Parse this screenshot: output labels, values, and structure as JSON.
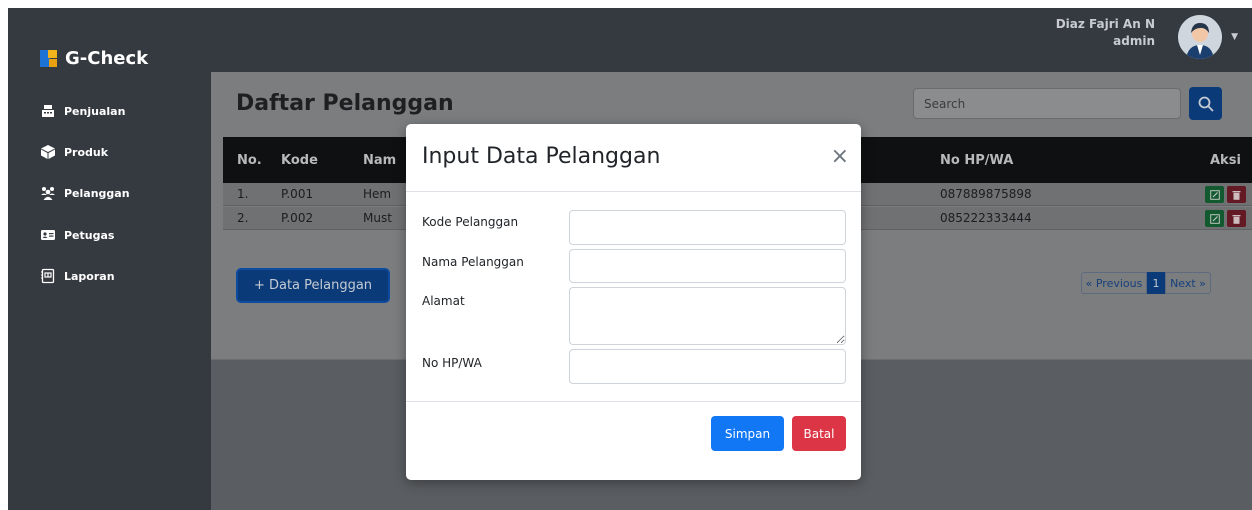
{
  "app": {
    "brand": "G-Check"
  },
  "sidebar": {
    "items": [
      {
        "label": "Penjualan",
        "icon": "cash-register-icon"
      },
      {
        "label": "Produk",
        "icon": "box-icon"
      },
      {
        "label": "Pelanggan",
        "icon": "users-icon"
      },
      {
        "label": "Petugas",
        "icon": "id-card-icon"
      },
      {
        "label": "Laporan",
        "icon": "report-icon"
      }
    ]
  },
  "user": {
    "name": "Diaz Fajri An N",
    "role": "admin"
  },
  "page": {
    "title": "Daftar Pelanggan",
    "search_placeholder": "Search"
  },
  "table": {
    "columns": [
      "No.",
      "Kode",
      "Nam",
      "No HP/WA",
      "Aksi"
    ],
    "rows": [
      {
        "no": "1.",
        "kode": "P.001",
        "nama": "Hem",
        "hp": "087889875898"
      },
      {
        "no": "2.",
        "kode": "P.002",
        "nama": "Must",
        "hp": "085222333444"
      }
    ]
  },
  "add_button": "+ Data Pelanggan",
  "pagination": {
    "prev": "« Previous",
    "current": "1",
    "next": "Next »"
  },
  "modal": {
    "title": "Input Data Pelanggan",
    "close": "×",
    "fields": [
      {
        "label": "Kode Pelanggan",
        "value": ""
      },
      {
        "label": "Nama Pelanggan",
        "value": ""
      },
      {
        "label": "Alamat",
        "value": ""
      },
      {
        "label": "No HP/WA",
        "value": ""
      }
    ],
    "save_label": "Simpan",
    "cancel_label": "Batal"
  },
  "colors": {
    "primary": "#1277f4",
    "danger": "#dc3545",
    "sidebar": "#353a40",
    "brand_blue": "#1d72d6",
    "brand_yellow": "#f2b31b"
  }
}
